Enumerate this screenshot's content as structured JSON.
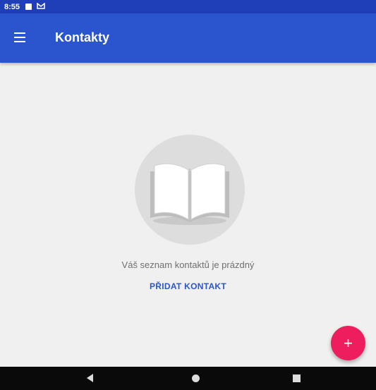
{
  "status_bar": {
    "time": "8:55",
    "icons": [
      "notification-square-icon",
      "sim-icon"
    ]
  },
  "app_bar": {
    "title": "Kontakty",
    "menu_icon": "menu-icon"
  },
  "empty_state": {
    "illustration_icon": "open-book-icon",
    "message": "Váš seznam kontaktů je prázdný",
    "action_label": "PŘIDAT KONTAKT"
  },
  "fab": {
    "label": "+",
    "color": "#ee1e5e"
  },
  "nav_bar": {
    "icons": [
      "back-icon",
      "home-icon",
      "recents-icon"
    ]
  },
  "colors": {
    "status_bar": "#1f3fb8",
    "app_bar": "#2b55cf",
    "background": "#f0f0f0",
    "accent": "#2b55cf"
  }
}
